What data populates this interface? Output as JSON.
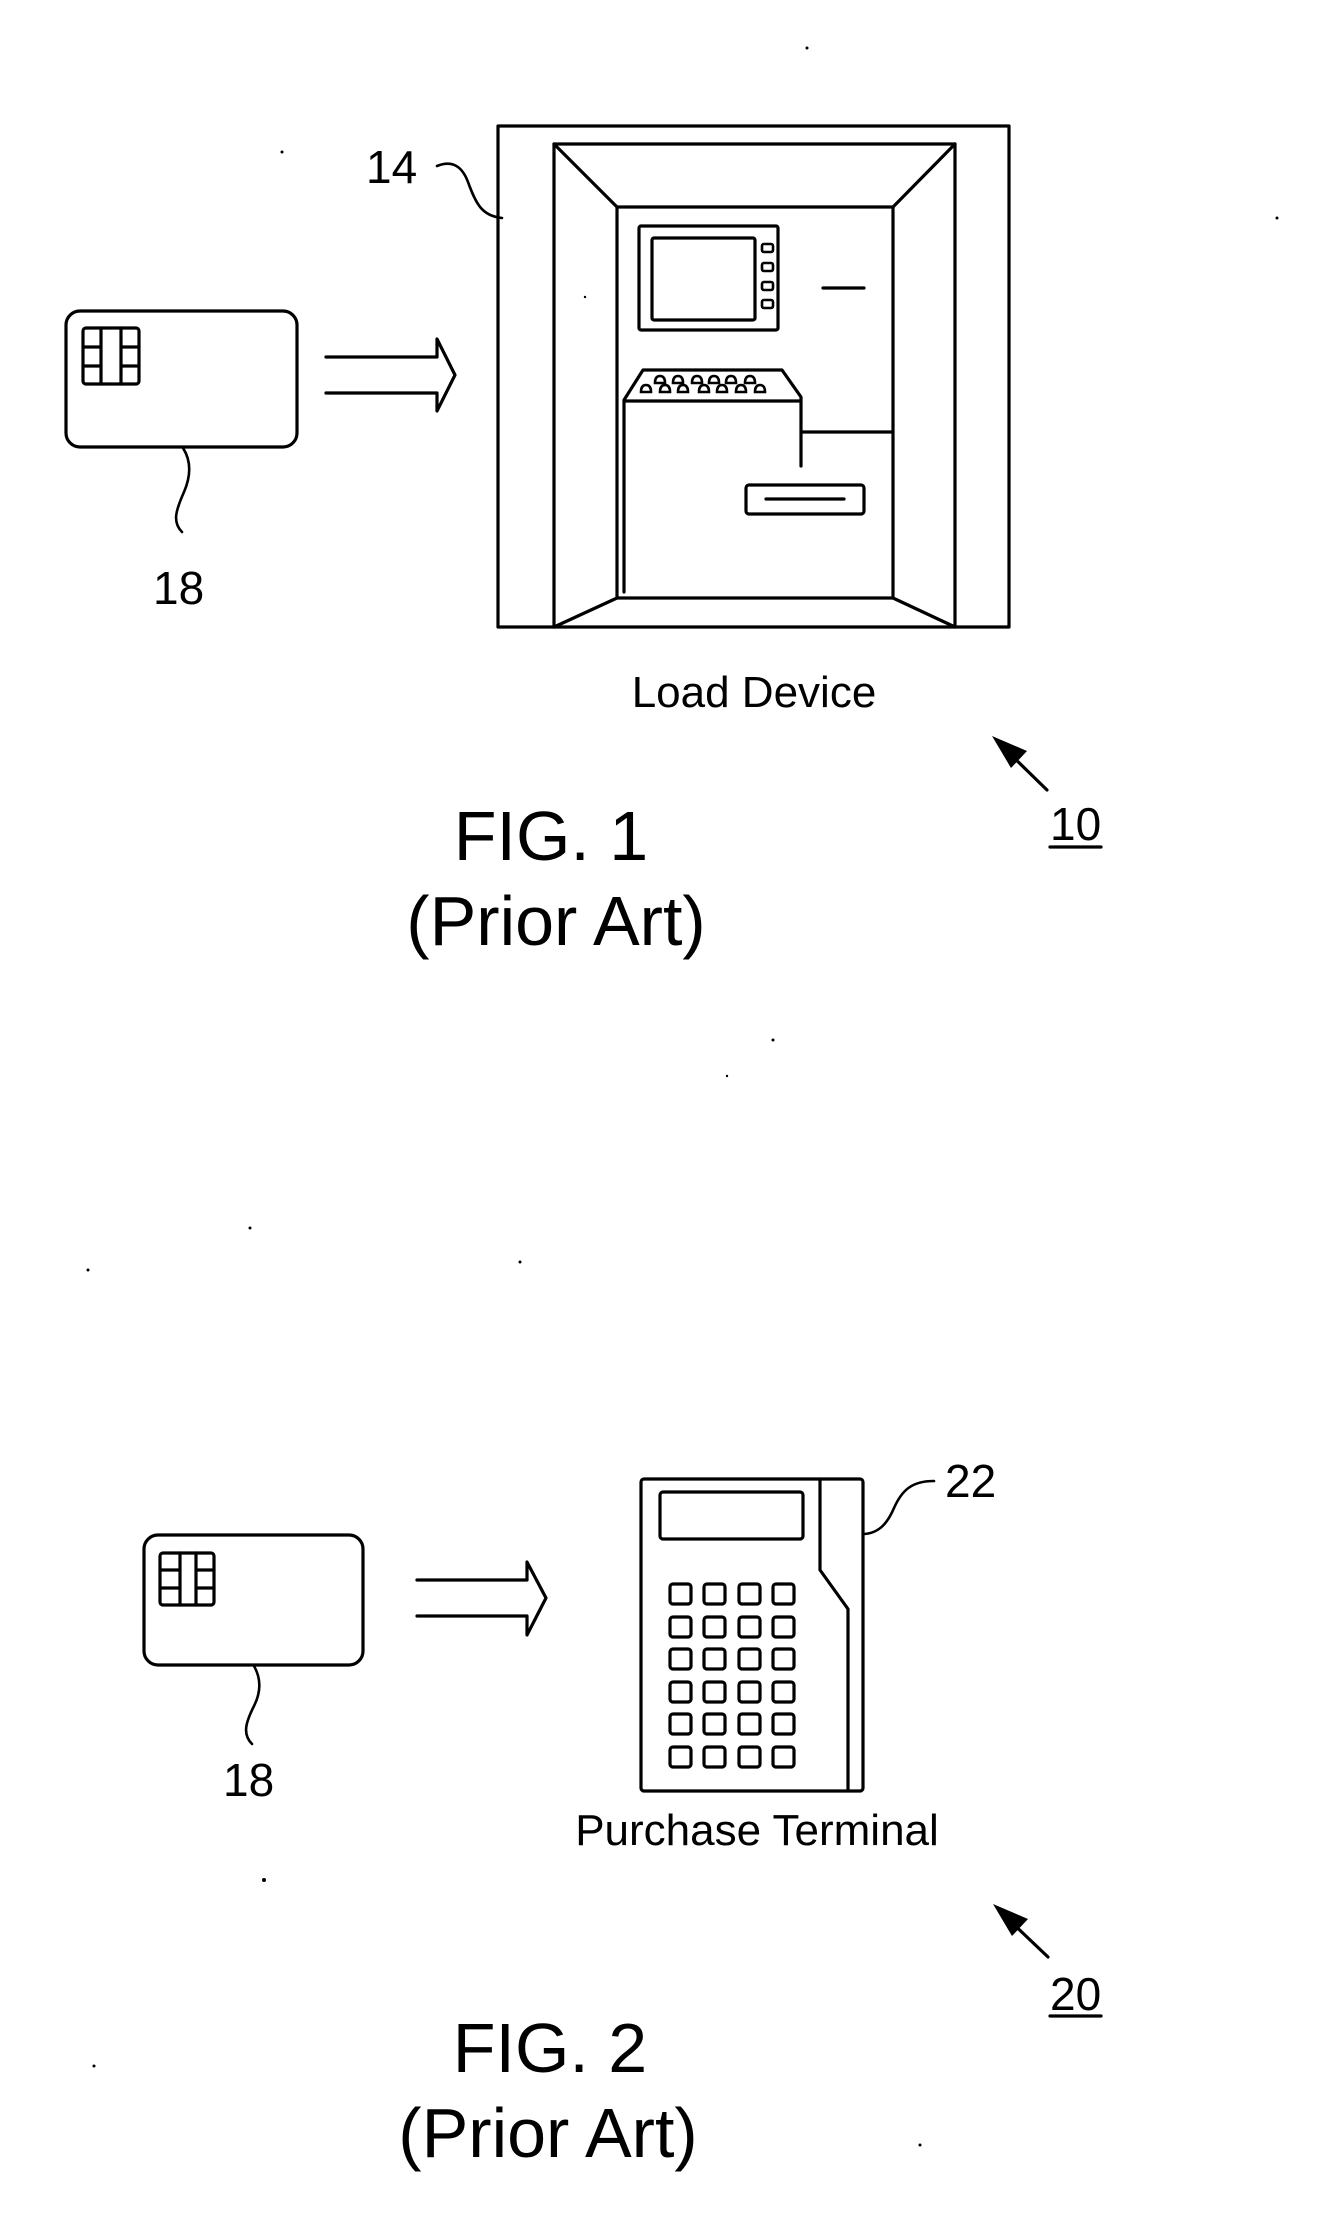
{
  "figures": [
    {
      "id": "fig1",
      "caption": "FIG. 1",
      "subcaption": "(Prior Art)",
      "assembly_ref": "10",
      "card": {
        "ref": "18",
        "icon": "smart-card-icon"
      },
      "transfer_arrow": {
        "icon": "double-arrow-right-icon"
      },
      "device": {
        "ref": "14",
        "label": "Load Device",
        "icon": "atm-kiosk-icon"
      }
    },
    {
      "id": "fig2",
      "caption": "FIG. 2",
      "subcaption": "(Prior Art)",
      "assembly_ref": "20",
      "card": {
        "ref": "18",
        "icon": "smart-card-icon"
      },
      "transfer_arrow": {
        "icon": "double-arrow-right-icon"
      },
      "device": {
        "ref": "22",
        "label": "Purchase Terminal",
        "icon": "payment-terminal-icon"
      }
    }
  ],
  "colors": {
    "ink": "#000000",
    "paper": "#ffffff"
  }
}
